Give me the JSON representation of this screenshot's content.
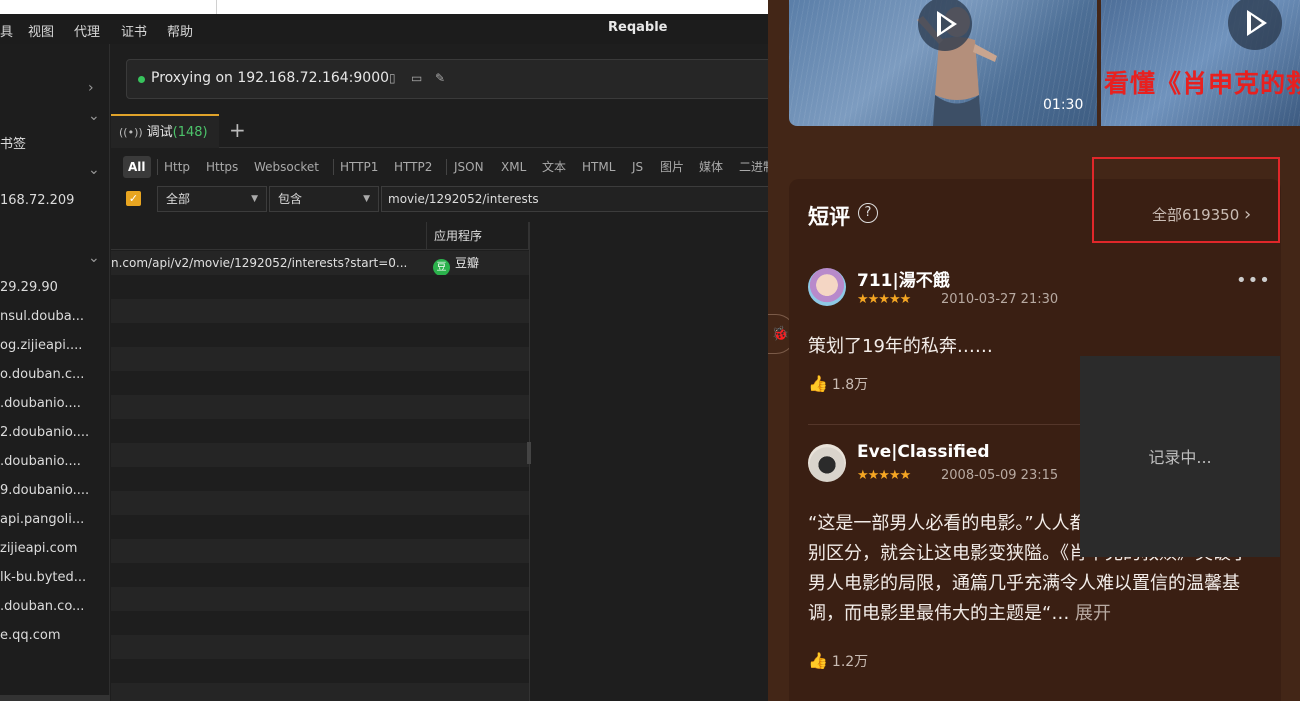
{
  "menu": {
    "items": [
      "具",
      "视图",
      "代理",
      "证书",
      "帮助"
    ],
    "app_title": "Reqable"
  },
  "sidebar": {
    "items": [
      "书签",
      "168.72.209",
      "29.29.90",
      "nsul.douba...",
      "og.zijieapi....",
      "o.douban.c...",
      ".doubanio....",
      "2.doubanio....",
      ".doubanio....",
      "9.doubanio....",
      "api.pangoli...",
      "zijieapi.com",
      "lk-bu.byted...",
      ".douban.co...",
      "e.qq.com"
    ]
  },
  "proxy": {
    "status": "Proxying on 192.168.72.164:9000",
    "status_color": "#37c35c"
  },
  "tabs": {
    "debug_label": "调试",
    "debug_count": "(148)",
    "add_label": "+"
  },
  "filters": [
    "All",
    "Http",
    "Https",
    "Websocket",
    "HTTP1",
    "HTTP2",
    "JSON",
    "XML",
    "文本",
    "HTML",
    "JS",
    "图片",
    "媒体",
    "二进制"
  ],
  "search": {
    "scope": "全部",
    "mode": "包含",
    "query": "movie/1292052/interests"
  },
  "table": {
    "col_app": "应用程序",
    "rows": [
      {
        "url": "n.com/api/v2/movie/1292052/interests?start=0...",
        "app": "豆瓣",
        "app_icon": "豆"
      }
    ]
  },
  "phone": {
    "video": {
      "duration": "01:30",
      "title": "看懂《肖申克的救"
    },
    "section_title": "短评",
    "help_icon": "?",
    "all_label": "全部619350",
    "all_chevron": "›",
    "reviews": [
      {
        "user": "711|湯不餓",
        "stars": "★★★★★",
        "date": "2010-03-27 21:30",
        "text": "策划了19年的私奔……",
        "likes": "1.8万"
      },
      {
        "user": "Eve|Classified",
        "stars": "★★★★★",
        "date": "2008-05-09 23:15",
        "text": "“这是一部男人必看的电影。”人人都这么说。但单纯从性别区分，就会让这电影变狭隘。《肖申克的救赎》突破了男人电影的局限，通篇几乎充满令人难以置信的温馨基调，而电影里最伟大的主题是“…",
        "expand": " 展开",
        "likes": "1.2万"
      }
    ],
    "more_icon": "•••",
    "recording": "记录中...",
    "highlight_color": "#e0272a"
  }
}
